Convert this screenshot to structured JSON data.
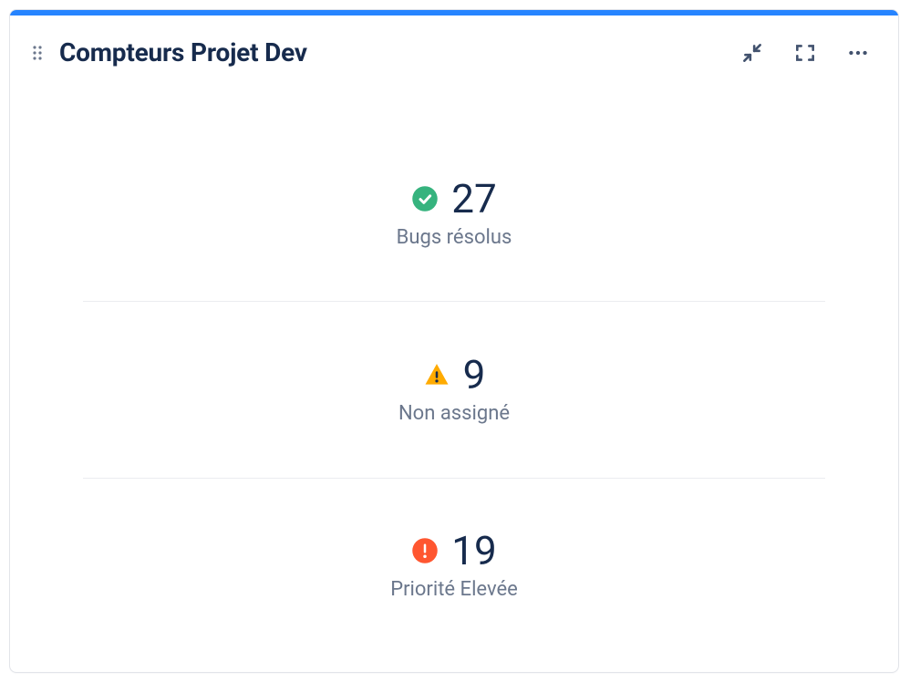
{
  "widget": {
    "title": "Compteurs Projet Dev"
  },
  "counters": [
    {
      "icon": "check-circle",
      "color_bg": "#36b37e",
      "color_fg": "#ffffff",
      "value": "27",
      "label": "Bugs résolus"
    },
    {
      "icon": "warning-triangle",
      "color_bg": "#ffab00",
      "color_fg": "#172b4d",
      "value": "9",
      "label": "Non assigné"
    },
    {
      "icon": "error-circle",
      "color_bg": "#ff5630",
      "color_fg": "#ffffff",
      "value": "19",
      "label": "Priorité Elevée"
    }
  ]
}
